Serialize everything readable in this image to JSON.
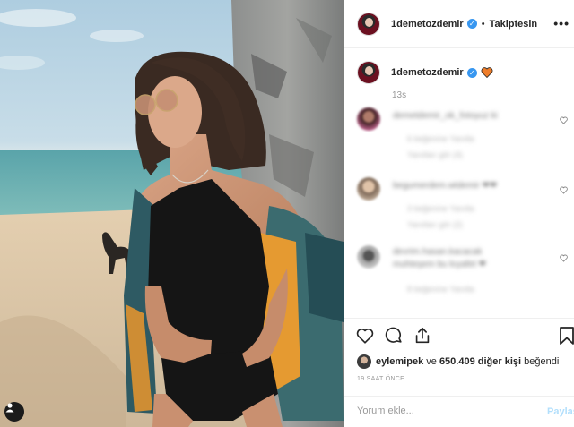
{
  "post": {
    "author": "1demetozdemir",
    "follow_state": "Takiptesin",
    "more_glyph": "•••",
    "separator": "•",
    "verified_glyph": "✓"
  },
  "caption": {
    "author": "1demetozdemir",
    "time": "13s"
  },
  "comments": [
    {
      "text": "demetdemir_ok_fotoyuz ki",
      "meta1": "6 beğenme    Yanıtla",
      "meta2": "Yanıtları gör (4)",
      "avatar_color": "#5a3b3b"
    },
    {
      "text": "begumerdem.wtdemir   ❤❤",
      "meta1": "3 beğenme    Yanıtla",
      "meta2": "Yanıtları gör (2)",
      "avatar_color": "#8a7868"
    },
    {
      "text": "devrim.hasan.kacacak",
      "text2": "muhteşem bu kıyafet ❤",
      "meta1": "8 beğenme    Yanıtla",
      "avatar_color": "#6a6a6a"
    }
  ],
  "likes": {
    "user": "eylemipek",
    "connector": " ve ",
    "count_text": "650.409 diğer kişi",
    "suffix": " beğendi"
  },
  "timestamp": "19 SAAT ÖNCE",
  "comment_input": {
    "placeholder": "Yorum ekle...",
    "submit_label": "Paylaş"
  },
  "icons": {
    "like": "heart-icon",
    "comment": "comment-icon",
    "share": "share-icon",
    "save": "bookmark-icon",
    "tag": "user-tag-icon"
  },
  "colors": {
    "verified": "#3897f0",
    "share_disabled": "#b2dffc",
    "heart_emoji": "#ee7d2a"
  }
}
